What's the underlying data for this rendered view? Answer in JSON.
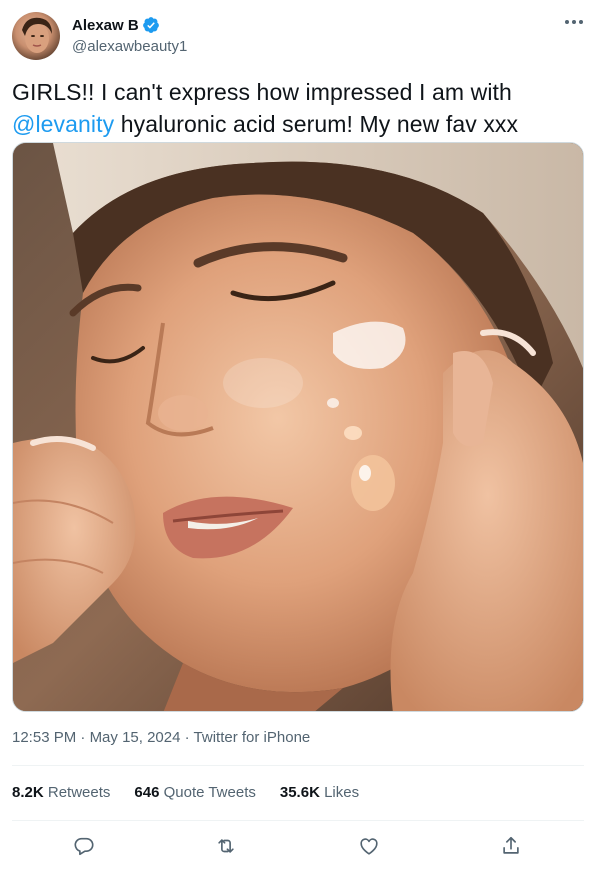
{
  "author": {
    "display_name": "Alexaw B",
    "handle": "@alexawbeauty1",
    "verified": true
  },
  "tweet": {
    "text_part1": "GIRLS!! I can't express how impressed I am with ",
    "mention": "@levanity",
    "text_part2": " hyaluronic acid serum! My new fav xxx"
  },
  "meta": {
    "time": "12:53 PM",
    "separator": " · ",
    "date": "May 15, 2024",
    "source": "Twitter for iPhone"
  },
  "stats": {
    "retweets_count": "8.2K",
    "retweets_label": " Retweets",
    "quotes_count": "646",
    "quotes_label": " Quote Tweets",
    "likes_count": "35.6K",
    "likes_label": " Likes"
  },
  "icons": {
    "more": "more-icon",
    "reply": "reply-icon",
    "retweet": "retweet-icon",
    "like": "like-icon",
    "share": "share-icon",
    "verified": "verified-badge-icon"
  },
  "colors": {
    "accent": "#1d9bf0",
    "text": "#0f1419",
    "secondary": "#536471",
    "divider": "#eff3f4"
  }
}
